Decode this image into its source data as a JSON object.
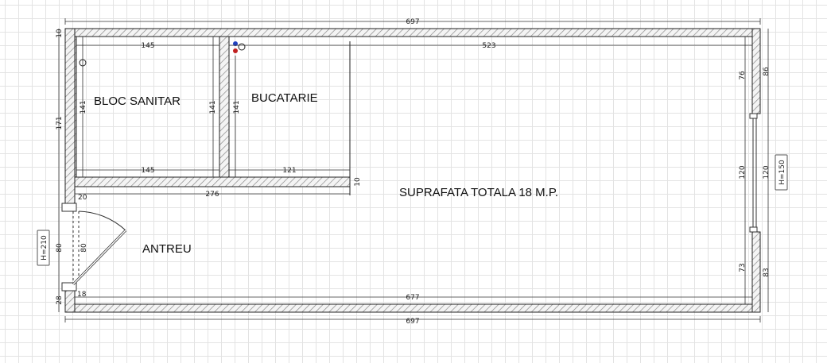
{
  "plan": {
    "rooms": {
      "bathroom": "BLOC SANITAR",
      "kitchen": "BUCATARIE",
      "hallway": "ANTREU",
      "total_area": "SUPRAFATA TOTALA 18 M.P."
    },
    "dimensions": {
      "top_outer": "697",
      "bottom_outer": "697",
      "bottom_inner": "677",
      "kitchen_top": "523",
      "bath_top": "145",
      "bath_bottom": "145",
      "bath_left": "141",
      "bath_right": "141",
      "kitchen_left": "141",
      "kitchen_bottom": "121",
      "partition_length": "276",
      "partition_thickness": "10",
      "left_outer_top": "10",
      "left_outer_mid": "171",
      "left_door_outer": "80",
      "left_door_inner": "80",
      "left_bottom_outer": "28",
      "left_bottom_inner": "18",
      "left_upper_gap": "20",
      "right_top_outer": "86",
      "right_top_inner": "76",
      "right_window_outer": "120",
      "right_window_inner": "120",
      "right_bottom_outer": "83",
      "right_bottom_inner": "73"
    },
    "tags": {
      "door_height": "H=210",
      "window_height": "H=150"
    }
  }
}
